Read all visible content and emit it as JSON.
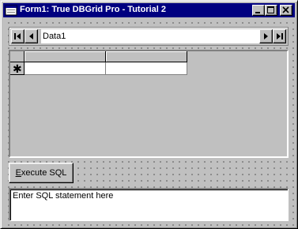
{
  "window": {
    "title": "Form1: True DBGrid Pro  - Tutorial 2",
    "controls": [
      "minimize",
      "maximize",
      "close"
    ]
  },
  "data_control": {
    "caption": "Data1",
    "buttons": [
      "first-record",
      "previous-record",
      "next-record",
      "last-record"
    ]
  },
  "grid": {
    "columns": [
      "",
      ""
    ],
    "rows": [
      {
        "selector": "✱",
        "cells": [
          "",
          ""
        ]
      }
    ]
  },
  "execute_button": {
    "access_key": "E",
    "rest": "xecute SQL"
  },
  "sql_box": {
    "value": "Enter SQL statement here"
  }
}
